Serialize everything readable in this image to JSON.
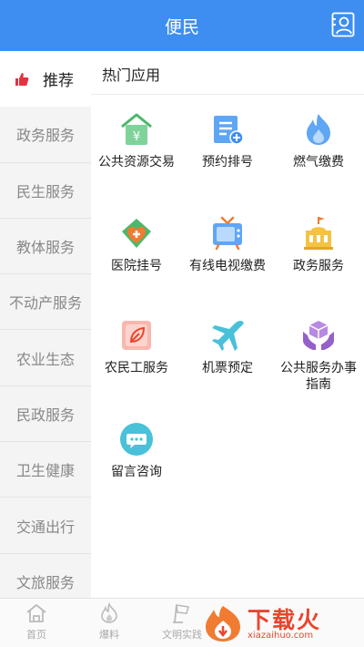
{
  "header": {
    "title": "便民"
  },
  "sidebar": {
    "items": [
      {
        "label": "推荐"
      },
      {
        "label": "政务服务"
      },
      {
        "label": "民生服务"
      },
      {
        "label": "教体服务"
      },
      {
        "label": "不动产服务"
      },
      {
        "label": "农业生态"
      },
      {
        "label": "民政服务"
      },
      {
        "label": "卫生健康"
      },
      {
        "label": "交通出行"
      },
      {
        "label": "文旅服务"
      }
    ]
  },
  "main": {
    "section_title": "热门应用",
    "apps": [
      {
        "label": "公共资源交易",
        "icon": "house-yen-icon"
      },
      {
        "label": "预约排号",
        "icon": "book-plus-icon"
      },
      {
        "label": "燃气缴费",
        "icon": "flame-icon"
      },
      {
        "label": "医院挂号",
        "icon": "heart-cross-icon"
      },
      {
        "label": "有线电视缴费",
        "icon": "tv-icon"
      },
      {
        "label": "政务服务",
        "icon": "government-building-icon"
      },
      {
        "label": "农民工服务",
        "icon": "leaf-card-icon"
      },
      {
        "label": "机票预定",
        "icon": "airplane-icon"
      },
      {
        "label": "公共服务办事指南",
        "icon": "hands-box-icon"
      },
      {
        "label": "留言咨询",
        "icon": "chat-bubble-icon"
      }
    ]
  },
  "bottom_nav": {
    "tabs": [
      {
        "label": "首页",
        "icon": "home-icon"
      },
      {
        "label": "爆料",
        "icon": "flame-icon"
      },
      {
        "label": "文明实践",
        "icon": "flag-icon"
      }
    ]
  },
  "watermark": {
    "name": "下载火",
    "site": "xiazaihuo.com"
  },
  "colors": {
    "primary": "#3d8ef0",
    "accent_orange": "#f07b31",
    "accent_green": "#4bb86b",
    "accent_purple": "#9460c9",
    "watermark_red": "#e9452d"
  }
}
